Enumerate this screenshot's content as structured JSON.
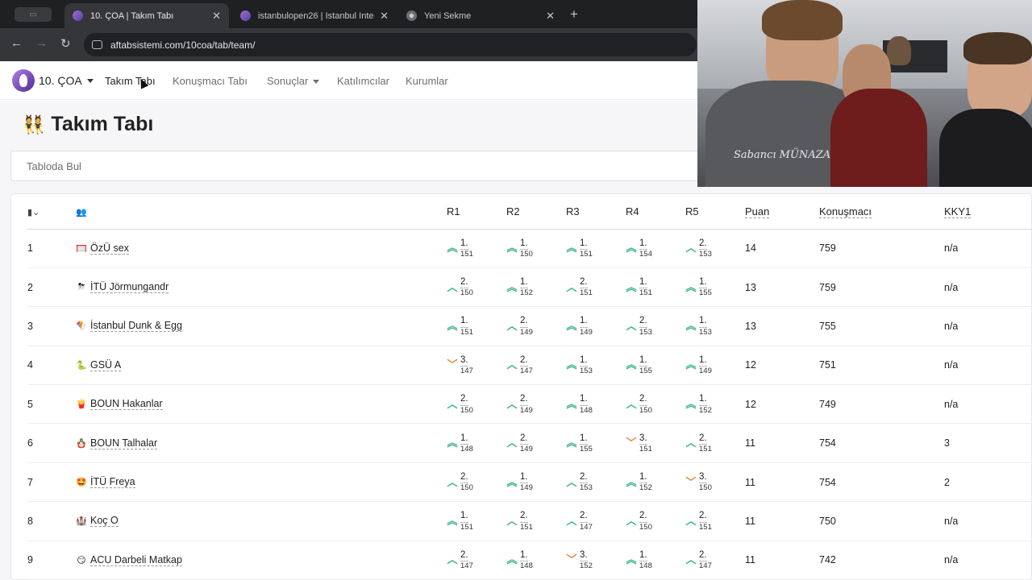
{
  "browser": {
    "tabs": [
      {
        "title": "10. ÇOA | Takım Tabı",
        "active": true
      },
      {
        "title": "istanbulopen26 | Istanbul Inte",
        "active": false
      },
      {
        "title": "Yeni Sekme",
        "active": false
      }
    ],
    "url": "aftabsistemi.com/10coa/tab/team/"
  },
  "nav": {
    "brand": "10. ÇOA",
    "links": [
      "Takım Tabı",
      "Konuşmacı Tabı",
      "Sonuçlar",
      "Katılımcılar",
      "Kurumlar"
    ]
  },
  "page": {
    "title_icon": "👯",
    "title": "Takım Tabı",
    "search_placeholder": "Tabloda Bul"
  },
  "table": {
    "headers": [
      "R1",
      "R2",
      "R3",
      "R4",
      "R5",
      "Puan",
      "Konuşmacı",
      "KKY1"
    ],
    "rows": [
      {
        "rank": "1",
        "emoji": "🥅",
        "team": "ÖzÜ sex",
        "results": [
          [
            "up2",
            "1.",
            "151"
          ],
          [
            "up2",
            "1.",
            "150"
          ],
          [
            "up2",
            "1.",
            "151"
          ],
          [
            "up2",
            "1.",
            "154"
          ],
          [
            "up",
            "2.",
            "153"
          ]
        ],
        "puan": "14",
        "konusmaci": "759",
        "kky1": "n/a"
      },
      {
        "rank": "2",
        "emoji": "⛈",
        "team": "İTÜ Jörmungandr",
        "results": [
          [
            "up",
            "2.",
            "150"
          ],
          [
            "up2",
            "1.",
            "152"
          ],
          [
            "up",
            "2.",
            "151"
          ],
          [
            "up2",
            "1.",
            "151"
          ],
          [
            "up2",
            "1.",
            "155"
          ]
        ],
        "puan": "13",
        "konusmaci": "759",
        "kky1": "n/a"
      },
      {
        "rank": "3",
        "emoji": "🪁",
        "team": "İstanbul Dunk & Egg",
        "results": [
          [
            "up2",
            "1.",
            "151"
          ],
          [
            "up",
            "2.",
            "149"
          ],
          [
            "up2",
            "1.",
            "149"
          ],
          [
            "up",
            "2.",
            "153"
          ],
          [
            "up2",
            "1.",
            "153"
          ]
        ],
        "puan": "13",
        "konusmaci": "755",
        "kky1": "n/a"
      },
      {
        "rank": "4",
        "emoji": "🐍",
        "team": "GSÜ A",
        "results": [
          [
            "down",
            "3.",
            "147"
          ],
          [
            "up",
            "2.",
            "147"
          ],
          [
            "up2",
            "1.",
            "153"
          ],
          [
            "up2",
            "1.",
            "155"
          ],
          [
            "up2",
            "1.",
            "149"
          ]
        ],
        "puan": "12",
        "konusmaci": "751",
        "kky1": "n/a"
      },
      {
        "rank": "5",
        "emoji": "🍟",
        "team": "BOUN Hakanlar",
        "results": [
          [
            "up",
            "2.",
            "150"
          ],
          [
            "up",
            "2.",
            "149"
          ],
          [
            "up2",
            "1.",
            "148"
          ],
          [
            "up",
            "2.",
            "150"
          ],
          [
            "up2",
            "1.",
            "152"
          ]
        ],
        "puan": "12",
        "konusmaci": "749",
        "kky1": "n/a"
      },
      {
        "rank": "6",
        "emoji": "🪆",
        "team": "BOUN Talhalar",
        "results": [
          [
            "up2",
            "1.",
            "148"
          ],
          [
            "up",
            "2.",
            "149"
          ],
          [
            "up2",
            "1.",
            "155"
          ],
          [
            "down",
            "3.",
            "151"
          ],
          [
            "up",
            "2.",
            "151"
          ]
        ],
        "puan": "11",
        "konusmaci": "754",
        "kky1": "3"
      },
      {
        "rank": "7",
        "emoji": "🤩",
        "team": "İTÜ Freya",
        "results": [
          [
            "up",
            "2.",
            "150"
          ],
          [
            "up2",
            "1.",
            "149"
          ],
          [
            "up",
            "2.",
            "153"
          ],
          [
            "up2",
            "1.",
            "152"
          ],
          [
            "down",
            "3.",
            "150"
          ]
        ],
        "puan": "11",
        "konusmaci": "754",
        "kky1": "2"
      },
      {
        "rank": "8",
        "emoji": "🏰",
        "team": "Koç O",
        "results": [
          [
            "up2",
            "1.",
            "151"
          ],
          [
            "up",
            "2.",
            "151"
          ],
          [
            "up",
            "2.",
            "147"
          ],
          [
            "up",
            "2.",
            "150"
          ],
          [
            "up",
            "2.",
            "151"
          ]
        ],
        "puan": "11",
        "konusmaci": "750",
        "kky1": "n/a"
      },
      {
        "rank": "9",
        "emoji": "😏",
        "team": "ACU Darbeli Matkap",
        "results": [
          [
            "up",
            "2.",
            "147"
          ],
          [
            "up2",
            "1.",
            "148"
          ],
          [
            "down",
            "3.",
            "152"
          ],
          [
            "up2",
            "1.",
            "148"
          ],
          [
            "up",
            "2.",
            "147"
          ]
        ],
        "puan": "11",
        "konusmaci": "742",
        "kky1": "n/a"
      }
    ]
  },
  "webcam": {
    "shirt_text": "Sabancı MÜNAZARA"
  }
}
